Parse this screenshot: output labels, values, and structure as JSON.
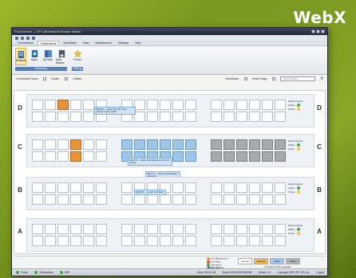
{
  "brand": {
    "text": "WebX"
  },
  "window": {
    "title": "FloorCentric — KFT-08 InfraOS Monitor Status"
  },
  "menu": {
    "tabs": [
      "Connections",
      "Dashboards",
      "Workflows",
      "Data",
      "Maintenance",
      "Settings",
      "Help"
    ],
    "active_index": 1
  },
  "ribbon": {
    "buttons": [
      "Realtime",
      "Spare",
      "By Rack",
      "Save Rackss",
      "Preset"
    ],
    "group_labels": [
      "Monitoring",
      "Filtering"
    ]
  },
  "filters": {
    "label": "Connected Rows",
    "option1": "Explin",
    "option2": "Unfilter",
    "right1": "Workflows",
    "right2": "Heard Tags",
    "search_placeholder": "Select Racks"
  },
  "rows": [
    "D",
    "C",
    "B",
    "A"
  ],
  "status_panel": {
    "header": "Rack Integrity",
    "status": "Status",
    "power": "Power"
  },
  "tooltips": [
    "Rack D2 — status OK, 48U, temp nominal, power 2.1kW",
    "Rack C3 — airflow fault detected, check fan module",
    "Rack C1 — alarm acknowledged, monitoring",
    "Rack B5 — service scheduled"
  ],
  "legend": {
    "items": [
      "Line Maintenance",
      "Line Fault",
      "Operations",
      "Port Error"
    ],
    "title": "CONNECTIONS LEGEND",
    "buttons": [
      "Normal",
      "Warning",
      "Fault",
      "Offline"
    ],
    "group_label": "PORT STATUS"
  },
  "statusbar": {
    "power": "Power",
    "temperature": "Temperature",
    "wifi": "WiFi",
    "model": "Model 2611-01B",
    "serial": "Serial 0000000261166008",
    "version": "Version 3.5",
    "copyright": "Copyright 2009 ISP-CRL Inc.",
    "logout": "Logout"
  },
  "colors": {
    "accent_green": "#8fb021",
    "fault_orange": "#e8923a",
    "info_blue": "#9cc6ea",
    "offline_gray": "#a7a9ab",
    "ok_green": "#3faa3f"
  }
}
